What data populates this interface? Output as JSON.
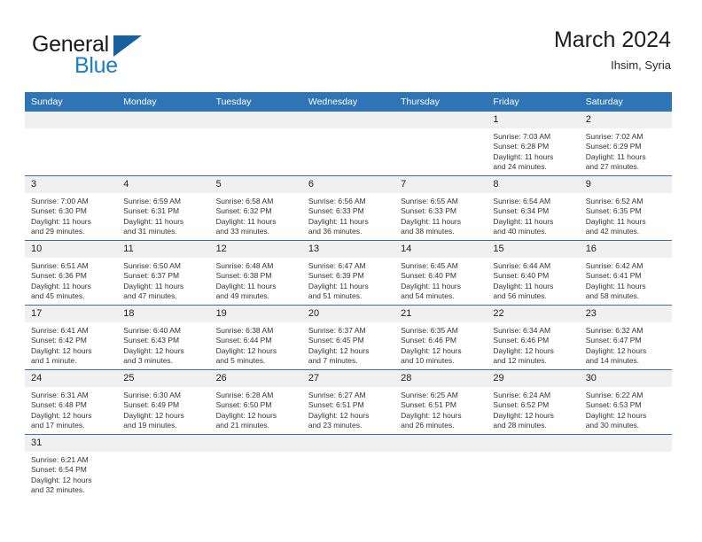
{
  "brand": {
    "name_part1": "General",
    "name_part2": "Blue",
    "triangle_icon": "triangle-logo-icon",
    "accent_color": "#1b7fc4",
    "dark_accent_color": "#175f9e"
  },
  "header": {
    "title": "March 2024",
    "location": "Ihsim, Syria"
  },
  "colors": {
    "header_blue": "#2f74b5",
    "daynum_band": "#f0f0f0",
    "week_separator": "#2f74b5"
  },
  "weekday_headers": [
    "Sunday",
    "Monday",
    "Tuesday",
    "Wednesday",
    "Thursday",
    "Friday",
    "Saturday"
  ],
  "weeks": [
    [
      {
        "day": "",
        "empty": true,
        "sunrise": "",
        "sunset": "",
        "daylight1": "",
        "daylight2": ""
      },
      {
        "day": "",
        "empty": true,
        "sunrise": "",
        "sunset": "",
        "daylight1": "",
        "daylight2": ""
      },
      {
        "day": "",
        "empty": true,
        "sunrise": "",
        "sunset": "",
        "daylight1": "",
        "daylight2": ""
      },
      {
        "day": "",
        "empty": true,
        "sunrise": "",
        "sunset": "",
        "daylight1": "",
        "daylight2": ""
      },
      {
        "day": "",
        "empty": true,
        "sunrise": "",
        "sunset": "",
        "daylight1": "",
        "daylight2": ""
      },
      {
        "day": "1",
        "empty": false,
        "sunrise": "Sunrise: 7:03 AM",
        "sunset": "Sunset: 6:28 PM",
        "daylight1": "Daylight: 11 hours",
        "daylight2": "and 24 minutes."
      },
      {
        "day": "2",
        "empty": false,
        "sunrise": "Sunrise: 7:02 AM",
        "sunset": "Sunset: 6:29 PM",
        "daylight1": "Daylight: 11 hours",
        "daylight2": "and 27 minutes."
      }
    ],
    [
      {
        "day": "3",
        "empty": false,
        "sunrise": "Sunrise: 7:00 AM",
        "sunset": "Sunset: 6:30 PM",
        "daylight1": "Daylight: 11 hours",
        "daylight2": "and 29 minutes."
      },
      {
        "day": "4",
        "empty": false,
        "sunrise": "Sunrise: 6:59 AM",
        "sunset": "Sunset: 6:31 PM",
        "daylight1": "Daylight: 11 hours",
        "daylight2": "and 31 minutes."
      },
      {
        "day": "5",
        "empty": false,
        "sunrise": "Sunrise: 6:58 AM",
        "sunset": "Sunset: 6:32 PM",
        "daylight1": "Daylight: 11 hours",
        "daylight2": "and 33 minutes."
      },
      {
        "day": "6",
        "empty": false,
        "sunrise": "Sunrise: 6:56 AM",
        "sunset": "Sunset: 6:33 PM",
        "daylight1": "Daylight: 11 hours",
        "daylight2": "and 36 minutes."
      },
      {
        "day": "7",
        "empty": false,
        "sunrise": "Sunrise: 6:55 AM",
        "sunset": "Sunset: 6:33 PM",
        "daylight1": "Daylight: 11 hours",
        "daylight2": "and 38 minutes."
      },
      {
        "day": "8",
        "empty": false,
        "sunrise": "Sunrise: 6:54 AM",
        "sunset": "Sunset: 6:34 PM",
        "daylight1": "Daylight: 11 hours",
        "daylight2": "and 40 minutes."
      },
      {
        "day": "9",
        "empty": false,
        "sunrise": "Sunrise: 6:52 AM",
        "sunset": "Sunset: 6:35 PM",
        "daylight1": "Daylight: 11 hours",
        "daylight2": "and 42 minutes."
      }
    ],
    [
      {
        "day": "10",
        "empty": false,
        "sunrise": "Sunrise: 6:51 AM",
        "sunset": "Sunset: 6:36 PM",
        "daylight1": "Daylight: 11 hours",
        "daylight2": "and 45 minutes."
      },
      {
        "day": "11",
        "empty": false,
        "sunrise": "Sunrise: 6:50 AM",
        "sunset": "Sunset: 6:37 PM",
        "daylight1": "Daylight: 11 hours",
        "daylight2": "and 47 minutes."
      },
      {
        "day": "12",
        "empty": false,
        "sunrise": "Sunrise: 6:48 AM",
        "sunset": "Sunset: 6:38 PM",
        "daylight1": "Daylight: 11 hours",
        "daylight2": "and 49 minutes."
      },
      {
        "day": "13",
        "empty": false,
        "sunrise": "Sunrise: 6:47 AM",
        "sunset": "Sunset: 6:39 PM",
        "daylight1": "Daylight: 11 hours",
        "daylight2": "and 51 minutes."
      },
      {
        "day": "14",
        "empty": false,
        "sunrise": "Sunrise: 6:45 AM",
        "sunset": "Sunset: 6:40 PM",
        "daylight1": "Daylight: 11 hours",
        "daylight2": "and 54 minutes."
      },
      {
        "day": "15",
        "empty": false,
        "sunrise": "Sunrise: 6:44 AM",
        "sunset": "Sunset: 6:40 PM",
        "daylight1": "Daylight: 11 hours",
        "daylight2": "and 56 minutes."
      },
      {
        "day": "16",
        "empty": false,
        "sunrise": "Sunrise: 6:42 AM",
        "sunset": "Sunset: 6:41 PM",
        "daylight1": "Daylight: 11 hours",
        "daylight2": "and 58 minutes."
      }
    ],
    [
      {
        "day": "17",
        "empty": false,
        "sunrise": "Sunrise: 6:41 AM",
        "sunset": "Sunset: 6:42 PM",
        "daylight1": "Daylight: 12 hours",
        "daylight2": "and 1 minute."
      },
      {
        "day": "18",
        "empty": false,
        "sunrise": "Sunrise: 6:40 AM",
        "sunset": "Sunset: 6:43 PM",
        "daylight1": "Daylight: 12 hours",
        "daylight2": "and 3 minutes."
      },
      {
        "day": "19",
        "empty": false,
        "sunrise": "Sunrise: 6:38 AM",
        "sunset": "Sunset: 6:44 PM",
        "daylight1": "Daylight: 12 hours",
        "daylight2": "and 5 minutes."
      },
      {
        "day": "20",
        "empty": false,
        "sunrise": "Sunrise: 6:37 AM",
        "sunset": "Sunset: 6:45 PM",
        "daylight1": "Daylight: 12 hours",
        "daylight2": "and 7 minutes."
      },
      {
        "day": "21",
        "empty": false,
        "sunrise": "Sunrise: 6:35 AM",
        "sunset": "Sunset: 6:46 PM",
        "daylight1": "Daylight: 12 hours",
        "daylight2": "and 10 minutes."
      },
      {
        "day": "22",
        "empty": false,
        "sunrise": "Sunrise: 6:34 AM",
        "sunset": "Sunset: 6:46 PM",
        "daylight1": "Daylight: 12 hours",
        "daylight2": "and 12 minutes."
      },
      {
        "day": "23",
        "empty": false,
        "sunrise": "Sunrise: 6:32 AM",
        "sunset": "Sunset: 6:47 PM",
        "daylight1": "Daylight: 12 hours",
        "daylight2": "and 14 minutes."
      }
    ],
    [
      {
        "day": "24",
        "empty": false,
        "sunrise": "Sunrise: 6:31 AM",
        "sunset": "Sunset: 6:48 PM",
        "daylight1": "Daylight: 12 hours",
        "daylight2": "and 17 minutes."
      },
      {
        "day": "25",
        "empty": false,
        "sunrise": "Sunrise: 6:30 AM",
        "sunset": "Sunset: 6:49 PM",
        "daylight1": "Daylight: 12 hours",
        "daylight2": "and 19 minutes."
      },
      {
        "day": "26",
        "empty": false,
        "sunrise": "Sunrise: 6:28 AM",
        "sunset": "Sunset: 6:50 PM",
        "daylight1": "Daylight: 12 hours",
        "daylight2": "and 21 minutes."
      },
      {
        "day": "27",
        "empty": false,
        "sunrise": "Sunrise: 6:27 AM",
        "sunset": "Sunset: 6:51 PM",
        "daylight1": "Daylight: 12 hours",
        "daylight2": "and 23 minutes."
      },
      {
        "day": "28",
        "empty": false,
        "sunrise": "Sunrise: 6:25 AM",
        "sunset": "Sunset: 6:51 PM",
        "daylight1": "Daylight: 12 hours",
        "daylight2": "and 26 minutes."
      },
      {
        "day": "29",
        "empty": false,
        "sunrise": "Sunrise: 6:24 AM",
        "sunset": "Sunset: 6:52 PM",
        "daylight1": "Daylight: 12 hours",
        "daylight2": "and 28 minutes."
      },
      {
        "day": "30",
        "empty": false,
        "sunrise": "Sunrise: 6:22 AM",
        "sunset": "Sunset: 6:53 PM",
        "daylight1": "Daylight: 12 hours",
        "daylight2": "and 30 minutes."
      }
    ],
    [
      {
        "day": "31",
        "empty": false,
        "sunrise": "Sunrise: 6:21 AM",
        "sunset": "Sunset: 6:54 PM",
        "daylight1": "Daylight: 12 hours",
        "daylight2": "and 32 minutes."
      },
      {
        "day": "",
        "empty": true,
        "sunrise": "",
        "sunset": "",
        "daylight1": "",
        "daylight2": ""
      },
      {
        "day": "",
        "empty": true,
        "sunrise": "",
        "sunset": "",
        "daylight1": "",
        "daylight2": ""
      },
      {
        "day": "",
        "empty": true,
        "sunrise": "",
        "sunset": "",
        "daylight1": "",
        "daylight2": ""
      },
      {
        "day": "",
        "empty": true,
        "sunrise": "",
        "sunset": "",
        "daylight1": "",
        "daylight2": ""
      },
      {
        "day": "",
        "empty": true,
        "sunrise": "",
        "sunset": "",
        "daylight1": "",
        "daylight2": ""
      },
      {
        "day": "",
        "empty": true,
        "sunrise": "",
        "sunset": "",
        "daylight1": "",
        "daylight2": ""
      }
    ]
  ]
}
